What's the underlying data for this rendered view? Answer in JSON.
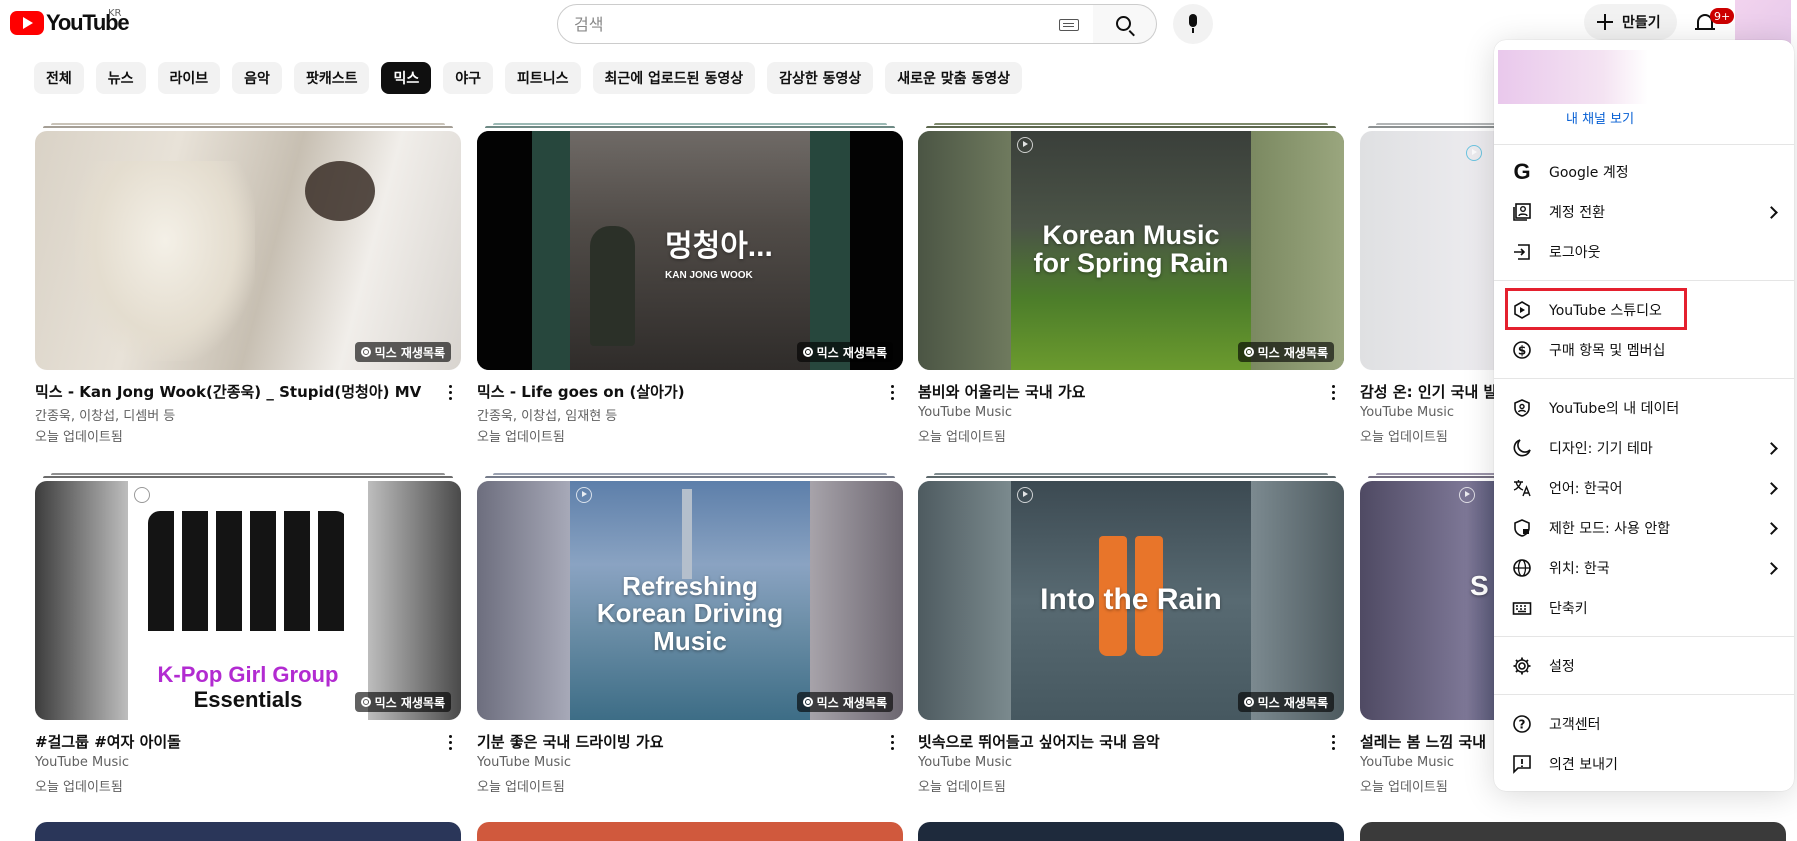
{
  "header": {
    "logo_text": "YouTube",
    "region": "KR",
    "search_placeholder": "검색",
    "create_label": "만들기",
    "notification_count": "9+"
  },
  "chips": [
    "전체",
    "뉴스",
    "라이브",
    "음악",
    "팟캐스트",
    "믹스",
    "야구",
    "피트니스",
    "최근에 업로드된 동영상",
    "감상한 동영상",
    "새로운 맞춤 동영상"
  ],
  "active_chip": "믹스",
  "badge_label": "믹스 재생목록",
  "videos": [
    {
      "title": "믹스 - Kan Jong Wook(간종욱) _ Stupid(멍청아) MV",
      "meta1": "간종욱, 이창섭, 디셈버 등",
      "meta2": "오늘 업데이트됨",
      "thumb_text": ""
    },
    {
      "title": "믹스 - Life goes on (살아가)",
      "meta1": "간종욱, 이창섭, 임재현 등",
      "meta2": "오늘 업데이트됨",
      "thumb_text": "멍청아...",
      "thumb_sub": "KAN JONG WOOK"
    },
    {
      "title": "봄비와 어울리는 국내 가요",
      "meta1": "YouTube Music",
      "meta2": "오늘 업데이트됨",
      "thumb_text": "Korean Music for Spring Rain"
    },
    {
      "title": "감성 온: 인기 국내 발",
      "meta1": "YouTube Music",
      "meta2": "오늘 업데이트됨",
      "thumb_text": ""
    },
    {
      "title": "#걸그룹 #여자 아이돌",
      "meta1": "YouTube Music",
      "meta2": "오늘 업데이트됨",
      "thumb_text": "K-Pop Girl Group",
      "thumb_sub": "Essentials"
    },
    {
      "title": "기분 좋은 국내 드라이빙 가요",
      "meta1": "YouTube Music",
      "meta2": "오늘 업데이트됨",
      "thumb_text": "Refreshing Korean Driving Music"
    },
    {
      "title": "빗속으로 뛰어들고 싶어지는 국내 음악",
      "meta1": "YouTube Music",
      "meta2": "오늘 업데이트됨",
      "thumb_text": "Into the Rain"
    },
    {
      "title": "설레는 봄 느낌 국내",
      "meta1": "YouTube Music",
      "meta2": "오늘 업데이트됨",
      "thumb_text": "S"
    }
  ],
  "menu": {
    "channel_link": "내 채널 보기",
    "items": [
      {
        "label": "Google 계정",
        "icon": "google-icon"
      },
      {
        "label": "계정 전환",
        "icon": "switch-account-icon"
      },
      {
        "label": "로그아웃",
        "icon": "sign-out-icon"
      },
      {
        "label": "YouTube 스튜디오",
        "icon": "studio-icon"
      },
      {
        "label": "구매 항목 및 멤버십",
        "icon": "dollar-icon"
      },
      {
        "label": "YouTube의 내 데이터",
        "icon": "shield-person-icon"
      },
      {
        "label": "디자인: 기기 테마",
        "icon": "moon-icon"
      },
      {
        "label": "언어: 한국어",
        "icon": "translate-icon"
      },
      {
        "label": "제한 모드: 사용 안함",
        "icon": "restricted-icon"
      },
      {
        "label": "위치: 한국",
        "icon": "globe-icon"
      },
      {
        "label": "단축키",
        "icon": "keyboard-icon"
      },
      {
        "label": "설정",
        "icon": "gear-icon"
      },
      {
        "label": "고객센터",
        "icon": "help-icon"
      },
      {
        "label": "의견 보내기",
        "icon": "feedback-icon"
      }
    ]
  },
  "colors": {
    "brand_red": "#ff0000",
    "badge_red": "#cc0000",
    "link_blue": "#065fd4",
    "highlight_red": "#e4202e"
  }
}
